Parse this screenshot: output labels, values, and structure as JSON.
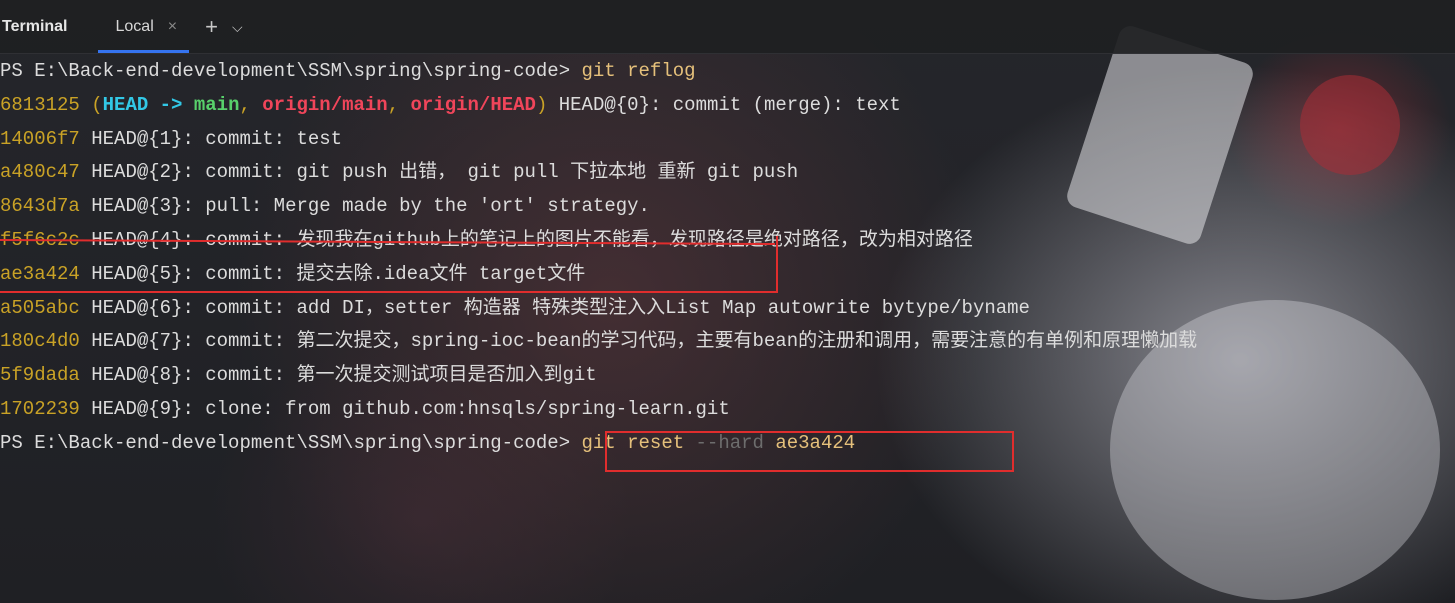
{
  "tabbar": {
    "title": "Terminal",
    "tab_label": "Local",
    "close_glyph": "×",
    "add_glyph": "+",
    "menu_glyph": "⌄",
    "icons": [
      "close-icon",
      "plus-icon",
      "chevron-down-icon"
    ],
    "accent": "#3574f0"
  },
  "terminal": {
    "prompt1": "PS E:\\Back-end-development\\SSM\\spring\\spring-code> ",
    "cmd1": "git reflog",
    "entries": [
      {
        "hash": "6813125",
        "text": ": commit (merge): text",
        "ref": "HEAD@{0}"
      },
      {
        "hash": "14006f7",
        "text": "HEAD@{1}: commit: test"
      },
      {
        "hash": "a480c47",
        "text": "HEAD@{2}: commit: git push 出错， git pull 下拉本地 重新 git push"
      },
      {
        "hash": "8643d7a",
        "text": "HEAD@{3}: pull: Merge made by the 'ort' strategy."
      },
      {
        "hash": "f5f6c2c",
        "text": "HEAD@{4}: commit: 发现我在github上的笔记上的图片不能看，发现路径是绝对路径，改为相对路径"
      },
      {
        "hash": "ae3a424",
        "text": "HEAD@{5}: commit: 提交去除.idea文件 target文件"
      },
      {
        "hash": "a505abc",
        "text": "HEAD@{6}: commit: add DI，setter 构造器 特殊类型注入入List Map autowrite bytype/byname"
      },
      {
        "hash": "180c4d0",
        "text": "HEAD@{7}: commit: 第二次提交，spring-ioc-bean的学习代码，主要有bean的注册和调用，需要注意的有单例和原理懒加载"
      },
      {
        "hash": "5f9dada",
        "text": "HEAD@{8}: commit: 第一次提交测试项目是否加入到git"
      },
      {
        "hash": "1702239",
        "text": "HEAD@{9}: clone: from github.com:hnsqls/spring-learn.git"
      }
    ],
    "decor": {
      "open_paren": "(",
      "head": "HEAD",
      "arrow": " -> ",
      "main": "main",
      "comma1": ", ",
      "origin_main": "origin/main",
      "comma2": ", ",
      "origin_head": "origin/HEAD",
      "close_paren": ") "
    },
    "prompt2": "PS E:\\Back-end-development\\SSM\\spring\\spring-code> ",
    "cmd2_git": "git reset ",
    "cmd2_flag": "--hard",
    "cmd2_arg": " ae3a424"
  },
  "colors": {
    "hash": "#c9a226",
    "command": "#e5c07b",
    "head": "#32c8e6",
    "branch": "#58d16b",
    "remote": "#f0455a",
    "highlight_box": "#e02d2d"
  }
}
